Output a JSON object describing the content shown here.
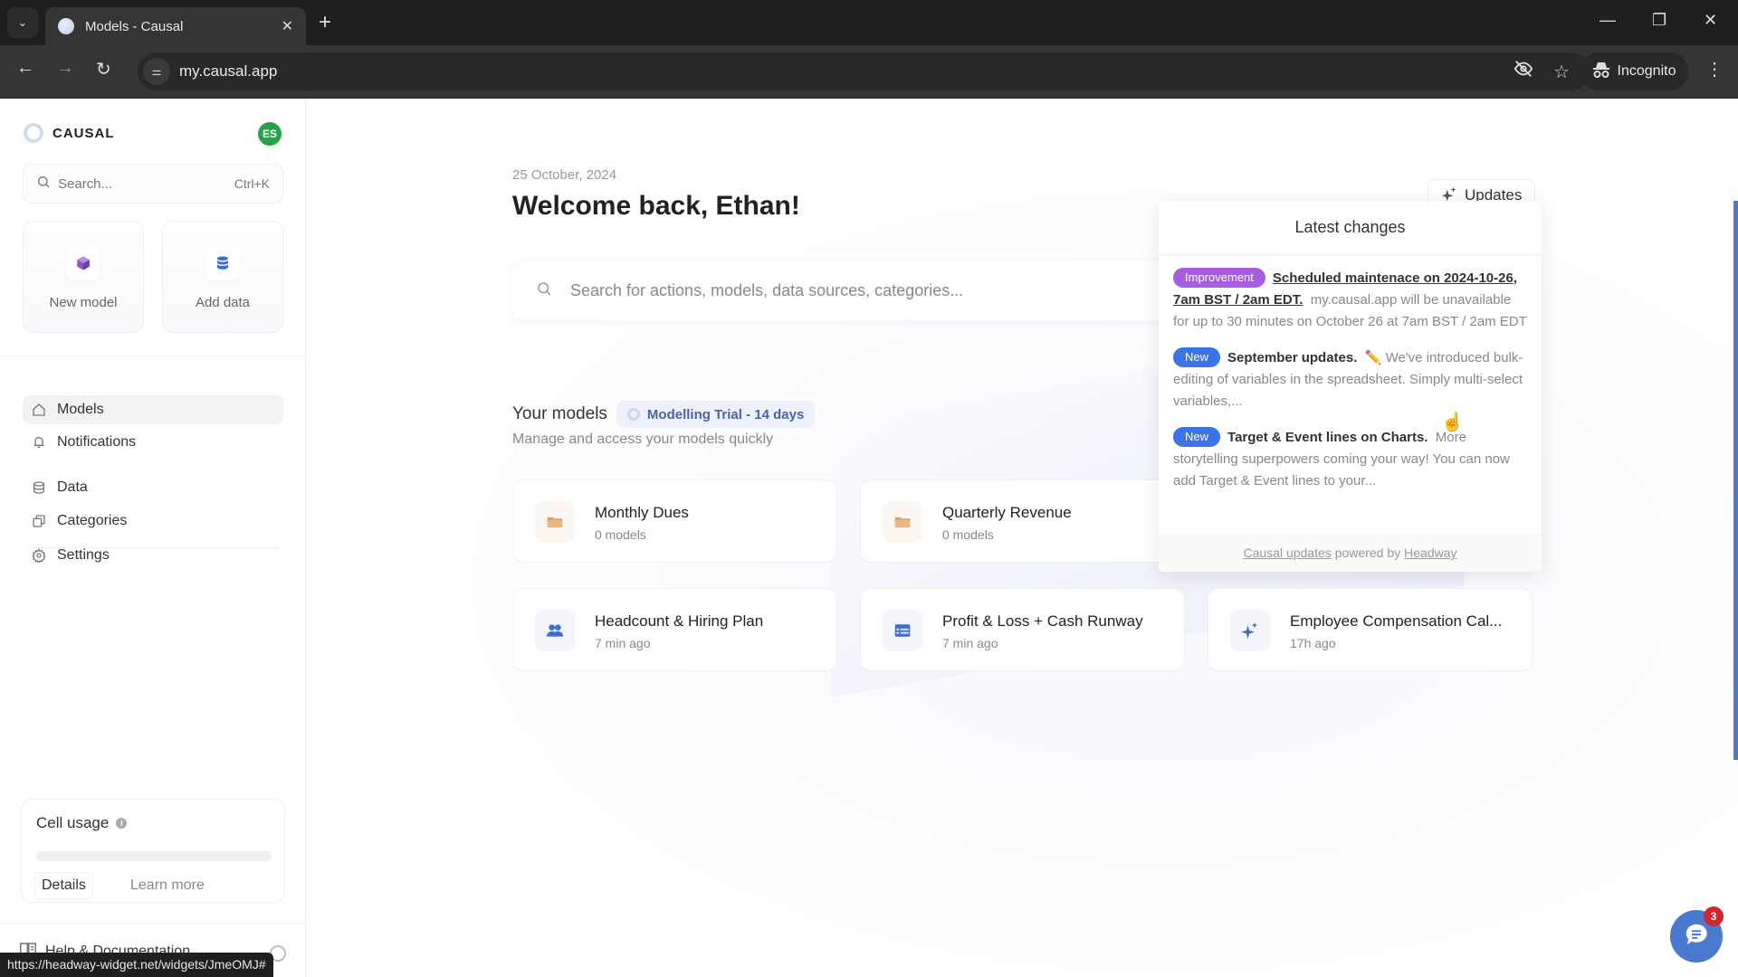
{
  "browser": {
    "tab_title": "Models - Causal",
    "url": "my.causal.app",
    "incognito_label": "Incognito",
    "status_url": "https://headway-widget.net/widgets/JmeOMJ#"
  },
  "sidebar": {
    "brand": "CAUSAL",
    "avatar_initials": "ES",
    "avatar_color": "#27a24a",
    "search_placeholder": "Search...",
    "search_shortcut": "Ctrl+K",
    "quick_actions": [
      {
        "label": "New model",
        "icon": "cube-icon"
      },
      {
        "label": "Add data",
        "icon": "database-icon"
      }
    ],
    "nav_primary": [
      {
        "label": "Models",
        "icon": "home-icon",
        "active": true
      },
      {
        "label": "Notifications",
        "icon": "bell-icon",
        "active": false
      }
    ],
    "nav_secondary": [
      {
        "label": "Data",
        "icon": "database-icon"
      },
      {
        "label": "Categories",
        "icon": "copy-icon"
      },
      {
        "label": "Settings",
        "icon": "gear-icon"
      }
    ],
    "cell_usage": {
      "title": "Cell usage",
      "usage_fraction": 0,
      "details_label": "Details",
      "learn_more_label": "Learn more"
    },
    "help_label": "Help & Documentation"
  },
  "main": {
    "date": "25 October, 2024",
    "welcome": "Welcome back, Ethan!",
    "search_placeholder": "Search for actions, models, data sources, categories...",
    "updates_label": "Updates",
    "models_title": "Your models",
    "trial_label": "Modelling Trial - 14 days",
    "models_subtitle": "Manage and access your models quickly",
    "cards": [
      {
        "title": "Monthly Dues",
        "subtitle": "0 models",
        "icon": "folder-icon"
      },
      {
        "title": "Quarterly Revenue",
        "subtitle": "0 models",
        "icon": "folder-icon"
      },
      {
        "title": "Headcount & Hiring Plan",
        "subtitle": "7 min ago",
        "icon": "people-icon"
      },
      {
        "title": "Profit & Loss + Cash Runway",
        "subtitle": "7 min ago",
        "icon": "table-icon"
      },
      {
        "title": "Employee Compensation Cal...",
        "subtitle": "17h ago",
        "icon": "sparkle-icon"
      }
    ]
  },
  "updates_popup": {
    "header": "Latest changes",
    "entries": [
      {
        "badge": "Improvement",
        "badge_color": "#a55ee0",
        "title": "Scheduled maintenace on 2024-10-26, 7am BST / 2am EDT.",
        "body": "my.causal.app will be unavailable for up to 30 minutes on October 26 at 7am BST / 2am EDT"
      },
      {
        "badge": "New",
        "badge_color": "#3b73e8",
        "title": "September updates.",
        "emoji": "✏️",
        "body": "We've introduced bulk-editing of variables in the spreadsheet. Simply multi-select variables,..."
      },
      {
        "badge": "New",
        "badge_color": "#3b73e8",
        "title": "Target & Event lines on Charts.",
        "body": "More storytelling superpowers coming your way! You can now add Target & Event lines to your..."
      }
    ],
    "footer_link1": "Causal updates",
    "footer_middle": "powered by",
    "footer_link2": "Headway"
  },
  "chat": {
    "unread_count": "3"
  }
}
